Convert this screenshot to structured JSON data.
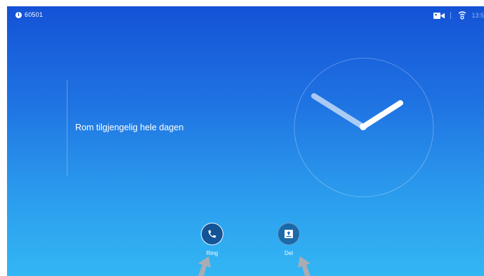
{
  "status_bar": {
    "system_id": "60501",
    "info_icon": "info-icon",
    "camera_icon": "video-camera-icon",
    "wifi_icon": "wifi-icon",
    "time": "13:5"
  },
  "room": {
    "message": "Rom tilgjengelig hele dagen"
  },
  "actions": {
    "call_label": "Ring",
    "call_icon": "phone-icon",
    "share_label": "Del",
    "share_icon": "share-screen-icon"
  },
  "colors": {
    "gradient_top": "#1452d6",
    "gradient_bottom": "#33b6f4",
    "pointer": "#a9adb2"
  }
}
